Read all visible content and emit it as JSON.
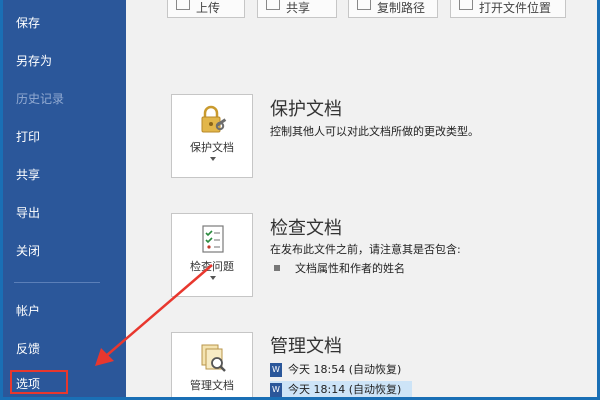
{
  "sidebar": {
    "items": [
      {
        "label": "保存"
      },
      {
        "label": "另存为"
      },
      {
        "label": "历史记录"
      },
      {
        "label": "打印"
      },
      {
        "label": "共享"
      },
      {
        "label": "导出"
      },
      {
        "label": "关闭"
      },
      {
        "label": "帐户"
      },
      {
        "label": "反馈"
      },
      {
        "label": "选项"
      }
    ]
  },
  "top_buttons": [
    {
      "label": "上传"
    },
    {
      "label": "共享"
    },
    {
      "label": "复制路径"
    },
    {
      "label": "打开文件位置"
    }
  ],
  "sections": {
    "protect": {
      "tile_label": "保护文档",
      "title": "保护文档",
      "desc": "控制其他人可以对此文档所做的更改类型。"
    },
    "inspect": {
      "tile_label": "检查问题",
      "title": "检查文档",
      "desc": "在发布此文件之前，请注意其是否包含:",
      "bullets": [
        "文档属性和作者的姓名"
      ]
    },
    "manage": {
      "tile_label": "管理文档",
      "title": "管理文档",
      "versions": [
        "今天 18:54 (自动恢复)",
        "今天 18:14 (自动恢复)"
      ]
    }
  },
  "colors": {
    "sidebar": "#2b579a",
    "highlight": "#e8372e",
    "content_bg": "#f1f1f1"
  }
}
